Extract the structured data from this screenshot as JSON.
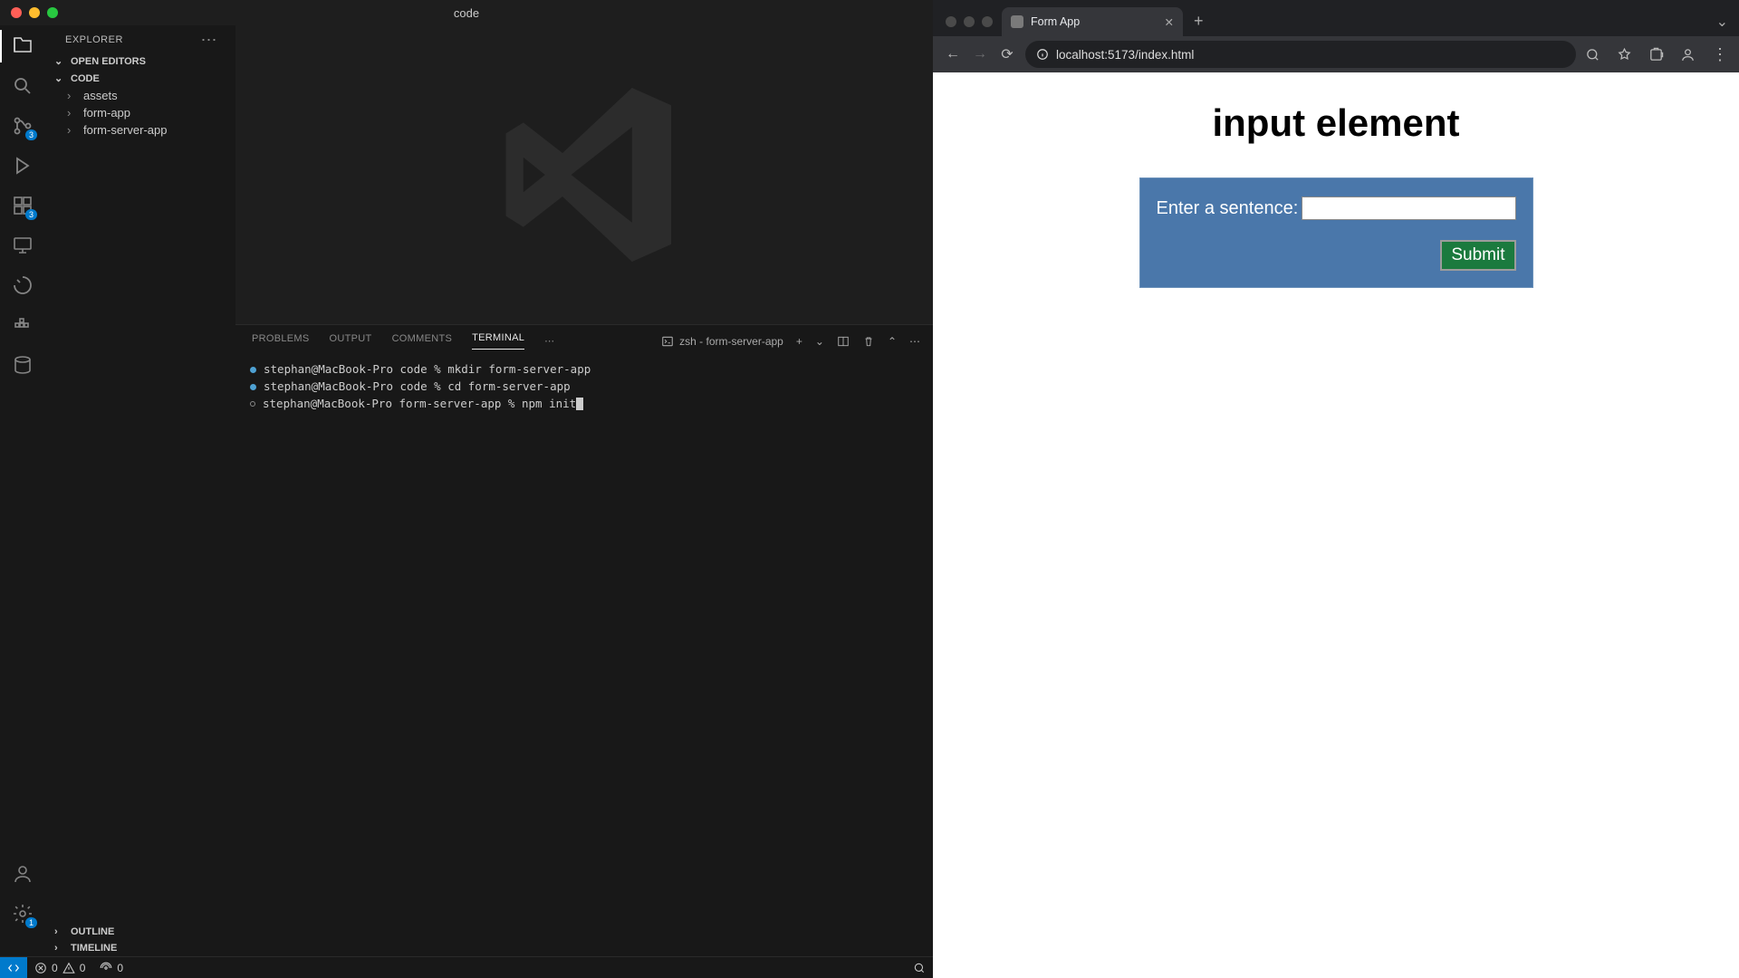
{
  "vscode": {
    "title": "code",
    "explorer_label": "EXPLORER",
    "open_editors_label": "OPEN EDITORS",
    "root_folder": "CODE",
    "folders": [
      "assets",
      "form-app",
      "form-server-app"
    ],
    "outline_label": "OUTLINE",
    "timeline_label": "TIMELINE",
    "source_control_badge": "3",
    "panel": {
      "tabs": [
        "PROBLEMS",
        "OUTPUT",
        "COMMENTS",
        "TERMINAL"
      ],
      "active_tab": "TERMINAL",
      "shell_label": "zsh - form-server-app",
      "plus": "+",
      "lines": [
        {
          "prompt": "stephan@MacBook-Pro code % ",
          "cmd": "mkdir form-server-app",
          "dot": "filled"
        },
        {
          "prompt": "stephan@MacBook-Pro code % ",
          "cmd": "cd form-server-app",
          "dot": "filled"
        },
        {
          "prompt": "stephan@MacBook-Pro form-server-app % ",
          "cmd": "npm init",
          "dot": "hollow",
          "cursor": true
        }
      ]
    },
    "status": {
      "errors": "0",
      "warnings": "0",
      "ports": "0"
    }
  },
  "browser": {
    "tab_title": "Form App",
    "url": "localhost:5173/index.html",
    "page": {
      "heading": "input element",
      "label": "Enter a sentence:",
      "submit": "Submit"
    }
  }
}
